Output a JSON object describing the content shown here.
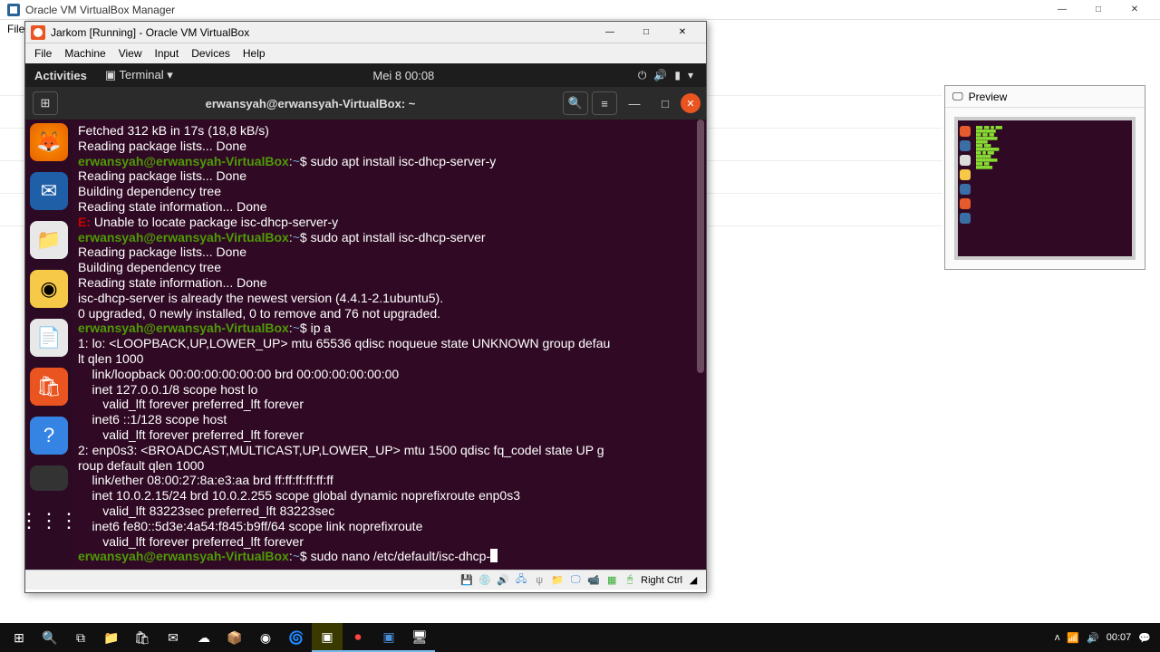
{
  "host": {
    "title": "Oracle VM VirtualBox Manager",
    "menu": "File",
    "win_min": "—",
    "win_max": "□",
    "win_close": "✕",
    "tray_time": "00:07",
    "tray_up": "ᴧ"
  },
  "vm": {
    "title": "Jarkom [Running] - Oracle VM VirtualBox",
    "menu": [
      "File",
      "Machine",
      "View",
      "Input",
      "Devices",
      "Help"
    ],
    "status_key": "Right Ctrl"
  },
  "gnome": {
    "activities": "Activities",
    "app": "Terminal",
    "clock": "Mei 8  00:08"
  },
  "term": {
    "title": "erwansyah@erwansyah-VirtualBox: ~",
    "prompt_user": "erwansyah@erwansyah-VirtualBox",
    "prompt_sep": ":",
    "prompt_path": "~",
    "prompt_dollar": "$ ",
    "lines": {
      "l1": "Fetched 312 kB in 17s (18,8 kB/s)",
      "l2": "Reading package lists... Done",
      "l3_cmd": "sudo apt install isc-dhcp-server-y",
      "l4": "Reading package lists... Done",
      "l5": "Building dependency tree",
      "l6": "Reading state information... Done",
      "l7e": "E:",
      "l7": " Unable to locate package isc-dhcp-server-y",
      "l8_cmd": "sudo apt install isc-dhcp-server",
      "l9": "Reading package lists... Done",
      "l10": "Building dependency tree",
      "l11": "Reading state information... Done",
      "l12": "isc-dhcp-server is already the newest version (4.4.1-2.1ubuntu5).",
      "l13": "0 upgraded, 0 newly installed, 0 to remove and 76 not upgraded.",
      "l14_cmd": "ip a",
      "l15": "1: lo: <LOOPBACK,UP,LOWER_UP> mtu 65536 qdisc noqueue state UNKNOWN group defau",
      "l15b": "lt qlen 1000",
      "l16": "    link/loopback 00:00:00:00:00:00 brd 00:00:00:00:00:00",
      "l17": "    inet 127.0.0.1/8 scope host lo",
      "l18": "       valid_lft forever preferred_lft forever",
      "l19": "    inet6 ::1/128 scope host",
      "l20": "       valid_lft forever preferred_lft forever",
      "l21": "2: enp0s3: <BROADCAST,MULTICAST,UP,LOWER_UP> mtu 1500 qdisc fq_codel state UP g",
      "l21b": "roup default qlen 1000",
      "l22": "    link/ether 08:00:27:8a:e3:aa brd ff:ff:ff:ff:ff:ff",
      "l23": "    inet 10.0.2.15/24 brd 10.0.2.255 scope global dynamic noprefixroute enp0s3",
      "l24": "       valid_lft 83223sec preferred_lft 83223sec",
      "l25": "    inet6 fe80::5d3e:4a54:f845:b9ff/64 scope link noprefixroute",
      "l26": "       valid_lft forever preferred_lft forever",
      "l27_cmd": "sudo nano /etc/default/isc-dhcp-"
    }
  },
  "preview": {
    "title": "Preview"
  }
}
